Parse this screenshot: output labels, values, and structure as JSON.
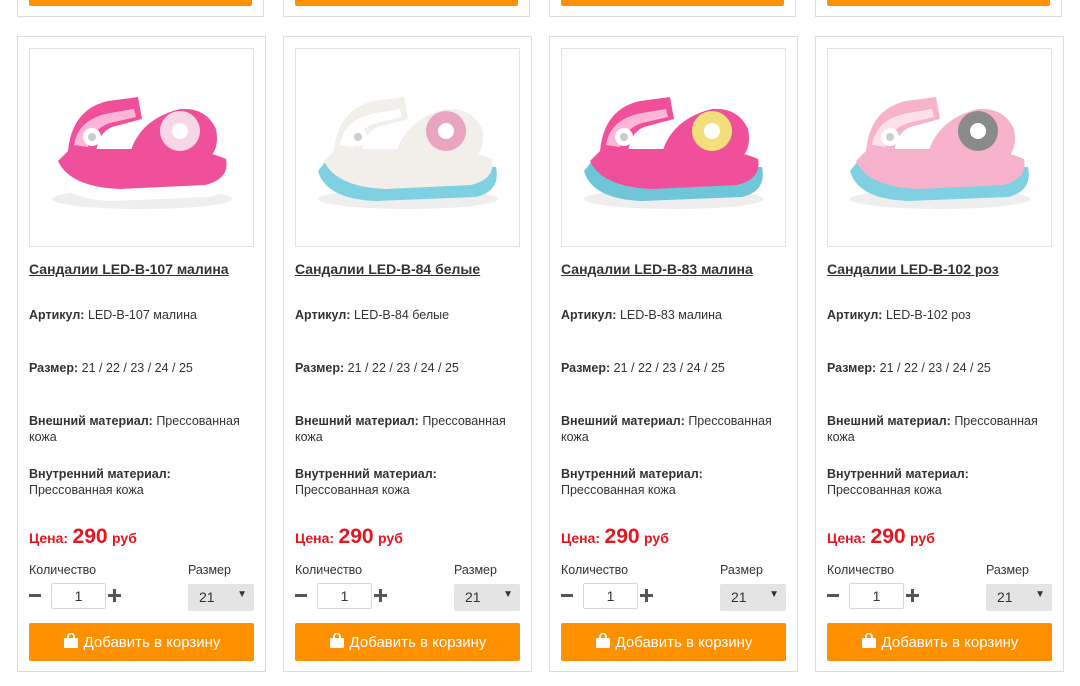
{
  "products": [
    {
      "title": "Сандалии LED-B-107 малина",
      "sku_label": "Артикул:",
      "sku": "LED-B-107 малина",
      "size_label": "Размер:",
      "sizes": "21 / 22 / 23 / 24 / 25",
      "outer_label": "Внешний материал:",
      "outer": "Прессованная кожа",
      "inner_label": "Внутренний материал:",
      "inner": "Прессованная кожа",
      "price_label": "Цена:",
      "price": "290",
      "currency": "руб",
      "qty_label": "Количество",
      "qty": "1",
      "size_select_label": "Размер",
      "size_selected": "21",
      "add_label": "Добавить в корзину",
      "colors": {
        "main": "#f0509a",
        "light": "#ffb6d6",
        "sole": "#ffffff",
        "flower": "#f7d6e6"
      }
    },
    {
      "title": "Сандалии LED-B-84 белые",
      "sku_label": "Артикул:",
      "sku": "LED-B-84 белые",
      "size_label": "Размер:",
      "sizes": "21 / 22 / 23 / 24 / 25",
      "outer_label": "Внешний материал:",
      "outer": "Прессованная кожа",
      "inner_label": "Внутренний материал:",
      "inner": "Прессованная кожа",
      "price_label": "Цена:",
      "price": "290",
      "currency": "руб",
      "qty_label": "Количество",
      "qty": "1",
      "size_select_label": "Размер",
      "size_selected": "21",
      "add_label": "Добавить в корзину",
      "colors": {
        "main": "#f2efea",
        "light": "#ffffff",
        "sole": "#7fd0e0",
        "flower": "#e9a5c0"
      }
    },
    {
      "title": "Сандалии LED-B-83 малина",
      "sku_label": "Артикул:",
      "sku": "LED-B-83 малина",
      "size_label": "Размер:",
      "sizes": "21 / 22 / 23 / 24 / 25",
      "outer_label": "Внешний материал:",
      "outer": "Прессованная кожа",
      "inner_label": "Внутренний материал:",
      "inner": "Прессованная кожа",
      "price_label": "Цена:",
      "price": "290",
      "currency": "руб",
      "qty_label": "Количество",
      "qty": "1",
      "size_select_label": "Размер",
      "size_selected": "21",
      "add_label": "Добавить в корзину",
      "colors": {
        "main": "#f0509a",
        "light": "#ffb6d6",
        "sole": "#6fc6d8",
        "flower": "#f3e07a"
      }
    },
    {
      "title": "Сандалии LED-B-102 роз",
      "sku_label": "Артикул:",
      "sku": "LED-B-102 роз",
      "size_label": "Размер:",
      "sizes": "21 / 22 / 23 / 24 / 25",
      "outer_label": "Внешний материал:",
      "outer": "Прессованная кожа",
      "inner_label": "Внутренний материал:",
      "inner": "Прессованная кожа",
      "price_label": "Цена:",
      "price": "290",
      "currency": "руб",
      "qty_label": "Количество",
      "qty": "1",
      "size_select_label": "Размер",
      "size_selected": "21",
      "add_label": "Добавить в корзину",
      "colors": {
        "main": "#f7b3cc",
        "light": "#fde0ea",
        "sole": "#7fd0e0",
        "flower": "#8a8a8a"
      }
    }
  ],
  "icons": {
    "dropdown": "triangle-down",
    "cart": "shopping-bag"
  },
  "accent_color": "#ff9100",
  "price_color": "#e8141e"
}
